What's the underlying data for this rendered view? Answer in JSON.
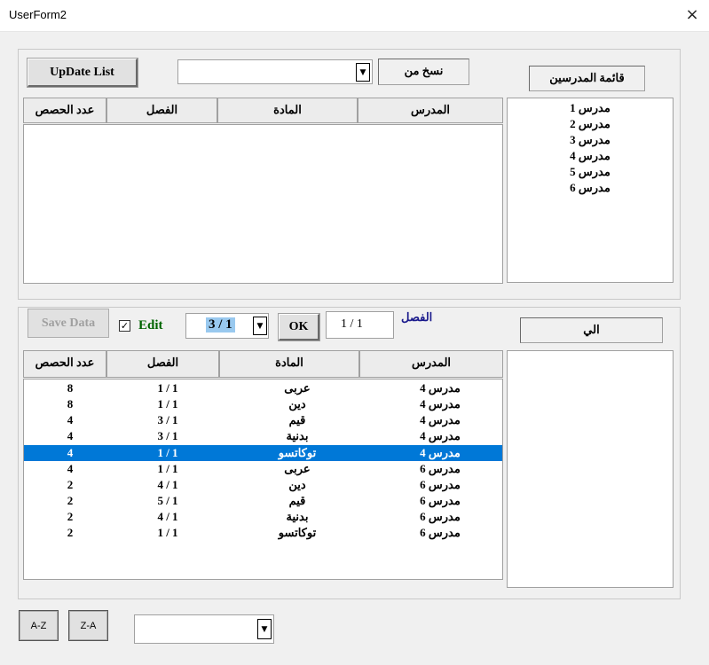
{
  "window": {
    "title": "UserForm2",
    "close_icon": "×"
  },
  "top_section": {
    "update_button": "UpDate List",
    "copy_from_label": "نسخ من",
    "copy_from_value": "",
    "teachers_label": "قائمة المدرسين",
    "headers": {
      "teacher": "المدرس",
      "subject": "المادة",
      "class": "الفصل",
      "count": "عدد الحصص"
    },
    "teachers": [
      "مدرس 1",
      "مدرس 2",
      "مدرس 3",
      "مدرس 4",
      "مدرس 5",
      "مدرس 6"
    ]
  },
  "bottom_section": {
    "save_button": "Save Data",
    "edit_label": "Edit",
    "edit_checked": "✓",
    "class_combo_value": "3 / 1",
    "ok_button": "OK",
    "class_textbox_value": "1 / 1",
    "class_label": "الفصل",
    "to_label": "الي",
    "headers": {
      "teacher": "المدرس",
      "subject": "المادة",
      "class": "الفصل",
      "count": "عدد الحصص"
    },
    "rows": [
      {
        "teacher": "مدرس 4",
        "subject": "عربى",
        "class": "1 / 1",
        "count": "8"
      },
      {
        "teacher": "مدرس 4",
        "subject": "دين",
        "class": "1 / 1",
        "count": "8"
      },
      {
        "teacher": "مدرس 4",
        "subject": "قيم",
        "class": "3 / 1",
        "count": "4"
      },
      {
        "teacher": "مدرس 4",
        "subject": "بدنية",
        "class": "3 / 1",
        "count": "4"
      },
      {
        "teacher": "مدرس 4",
        "subject": "توكاتسو",
        "class": "1 / 1",
        "count": "4"
      },
      {
        "teacher": "مدرس 6",
        "subject": "عربى",
        "class": "1 / 1",
        "count": "4"
      },
      {
        "teacher": "مدرس 6",
        "subject": "دين",
        "class": "4 / 1",
        "count": "2"
      },
      {
        "teacher": "مدرس 6",
        "subject": "قيم",
        "class": "5 / 1",
        "count": "2"
      },
      {
        "teacher": "مدرس 6",
        "subject": "بدنية",
        "class": "4 / 1",
        "count": "2"
      },
      {
        "teacher": "مدرس 6",
        "subject": "توكاتسو",
        "class": "1 / 1",
        "count": "2"
      }
    ],
    "selected_row": 4
  },
  "footer": {
    "az_button": "A-Z",
    "za_button": "Z-A",
    "sort_combo_value": ""
  },
  "icons": {
    "dropdown_arrow": "▼"
  }
}
